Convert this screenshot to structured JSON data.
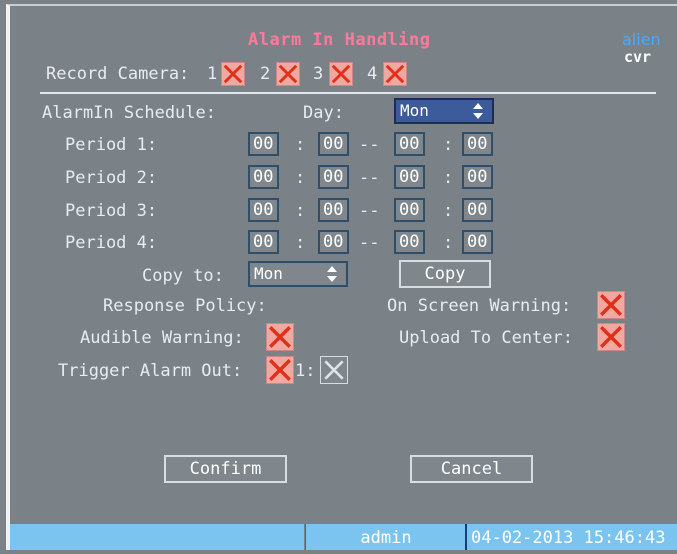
{
  "header": {
    "title": "Alarm In Handling",
    "logo_line1": "alien",
    "logo_line2": "cvr"
  },
  "record_camera": {
    "label": "Record Camera:",
    "cameras": [
      {
        "num": "1",
        "checked": true
      },
      {
        "num": "2",
        "checked": true
      },
      {
        "num": "3",
        "checked": true
      },
      {
        "num": "4",
        "checked": true
      }
    ]
  },
  "schedule": {
    "label": "AlarmIn Schedule:",
    "day_label": "Day:",
    "day_value": "Mon",
    "periods": [
      {
        "label": "Period 1:",
        "start_h": "00",
        "start_m": "00",
        "end_h": "00",
        "end_m": "00"
      },
      {
        "label": "Period 2:",
        "start_h": "00",
        "start_m": "00",
        "end_h": "00",
        "end_m": "00"
      },
      {
        "label": "Period 3:",
        "start_h": "00",
        "start_m": "00",
        "end_h": "00",
        "end_m": "00"
      },
      {
        "label": "Period 4:",
        "start_h": "00",
        "start_m": "00",
        "end_h": "00",
        "end_m": "00"
      }
    ],
    "colon": ":",
    "dash": "--",
    "copy_to_label": "Copy to:",
    "copy_to_value": "Mon",
    "copy_button": "Copy"
  },
  "response": {
    "label": "Response Policy:",
    "on_screen_warning_label": "On Screen Warning:",
    "on_screen_warning": true,
    "audible_warning_label": "Audible Warning:",
    "audible_warning": true,
    "upload_to_center_label": "Upload To Center:",
    "upload_to_center": true,
    "trigger_alarm_out_label": "Trigger Alarm Out:",
    "trigger_alarm_out": true,
    "alarm_out_1_label": "1:",
    "alarm_out_1": false
  },
  "buttons": {
    "confirm": "Confirm",
    "cancel": "Cancel"
  },
  "status": {
    "user": "admin",
    "datetime": "04-02-2013 15:46:43"
  },
  "colors": {
    "accent_title": "#ff7a9a",
    "checkbox_on": "#f0a8a0",
    "x_mark": "#e0301a",
    "status_bar": "#7cc4f0",
    "select_active": "#3d5a9a"
  }
}
